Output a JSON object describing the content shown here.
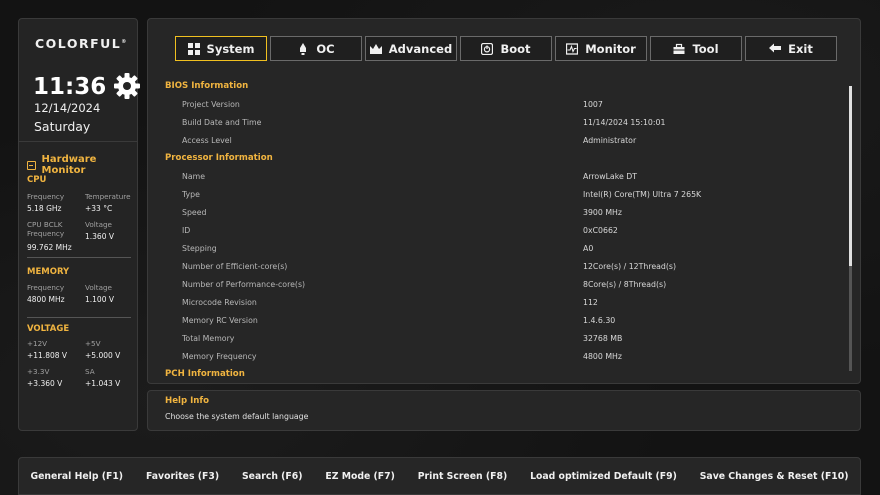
{
  "sidebar": {
    "brand": "COLORFUL",
    "brand_mark": "®",
    "time": "11:36",
    "date": "12/14/2024",
    "day": "Saturday",
    "hardware_monitor": {
      "title": "Hardware Monitor",
      "cpu": {
        "section": "CPU",
        "frequency_label": "Frequency",
        "frequency_value": "5.18 GHz",
        "temperature_label": "Temperature",
        "temperature_value": "+33 °C",
        "bclk_label": "CPU BCLK Frequency",
        "bclk_value": "99.762 MHz",
        "voltage_label": "Voltage",
        "voltage_value": "1.360 V"
      },
      "memory": {
        "section": "MEMORY",
        "frequency_label": "Frequency",
        "frequency_value": "4800 MHz",
        "voltage_label": "Voltage",
        "voltage_value": "1.100 V"
      },
      "voltage": {
        "section": "VOLTAGE",
        "v12_label": "+12V",
        "v12_value": "+11.808 V",
        "v5_label": "+5V",
        "v5_value": "+5.000 V",
        "v33_label": "+3.3V",
        "v33_value": "+3.360 V",
        "sa_label": "SA",
        "sa_value": "+1.043 V"
      }
    }
  },
  "tabs": [
    {
      "label": "System",
      "icon": "grid-icon",
      "active": true
    },
    {
      "label": "OC",
      "icon": "rocket-icon",
      "active": false
    },
    {
      "label": "Advanced",
      "icon": "crown-icon",
      "active": false
    },
    {
      "label": "Boot",
      "icon": "power-icon",
      "active": false
    },
    {
      "label": "Monitor",
      "icon": "pulse-icon",
      "active": false
    },
    {
      "label": "Tool",
      "icon": "toolbox-icon",
      "active": false
    },
    {
      "label": "Exit",
      "icon": "back-arrow-icon",
      "active": false
    }
  ],
  "info_rows": [
    {
      "type": "header",
      "label": "BIOS Information"
    },
    {
      "type": "item",
      "label": "Project Version",
      "value": "1007"
    },
    {
      "type": "item",
      "label": "Build Date and Time",
      "value": "11/14/2024 15:10:01"
    },
    {
      "type": "item",
      "label": "Access Level",
      "value": "Administrator"
    },
    {
      "type": "header",
      "label": "Processor Information"
    },
    {
      "type": "item",
      "label": "Name",
      "value": "ArrowLake DT"
    },
    {
      "type": "item",
      "label": "Type",
      "value": "Intel(R) Core(TM) Ultra 7 265K"
    },
    {
      "type": "item",
      "label": "Speed",
      "value": "3900 MHz"
    },
    {
      "type": "item",
      "label": "ID",
      "value": "0xC0662"
    },
    {
      "type": "item",
      "label": "Stepping",
      "value": "A0"
    },
    {
      "type": "item",
      "label": "Number of Efficient-core(s)",
      "value": "12Core(s) / 12Thread(s)"
    },
    {
      "type": "item",
      "label": "Number of Performance-core(s)",
      "value": "8Core(s) / 8Thread(s)"
    },
    {
      "type": "item",
      "label": "Microcode Revision",
      "value": "112"
    },
    {
      "type": "item",
      "label": "Memory RC Version",
      "value": "1.4.6.30"
    },
    {
      "type": "item",
      "label": "Total Memory",
      "value": "32768 MB"
    },
    {
      "type": "item",
      "label": "Memory Frequency",
      "value": "4800 MHz"
    },
    {
      "type": "header",
      "label": "PCH Information"
    }
  ],
  "help": {
    "title": "Help Info",
    "text": "Choose the system default language"
  },
  "footer": [
    "General Help (F1)",
    "Favorites (F3)",
    "Search (F6)",
    "EZ Mode (F7)",
    "Print Screen (F8)",
    "Load optimized Default (F9)",
    "Save Changes & Reset (F10)"
  ],
  "colors": {
    "accent": "#f0b440",
    "active_tab_border": "#f0c020",
    "panel": "#262626",
    "background": "#141414"
  }
}
